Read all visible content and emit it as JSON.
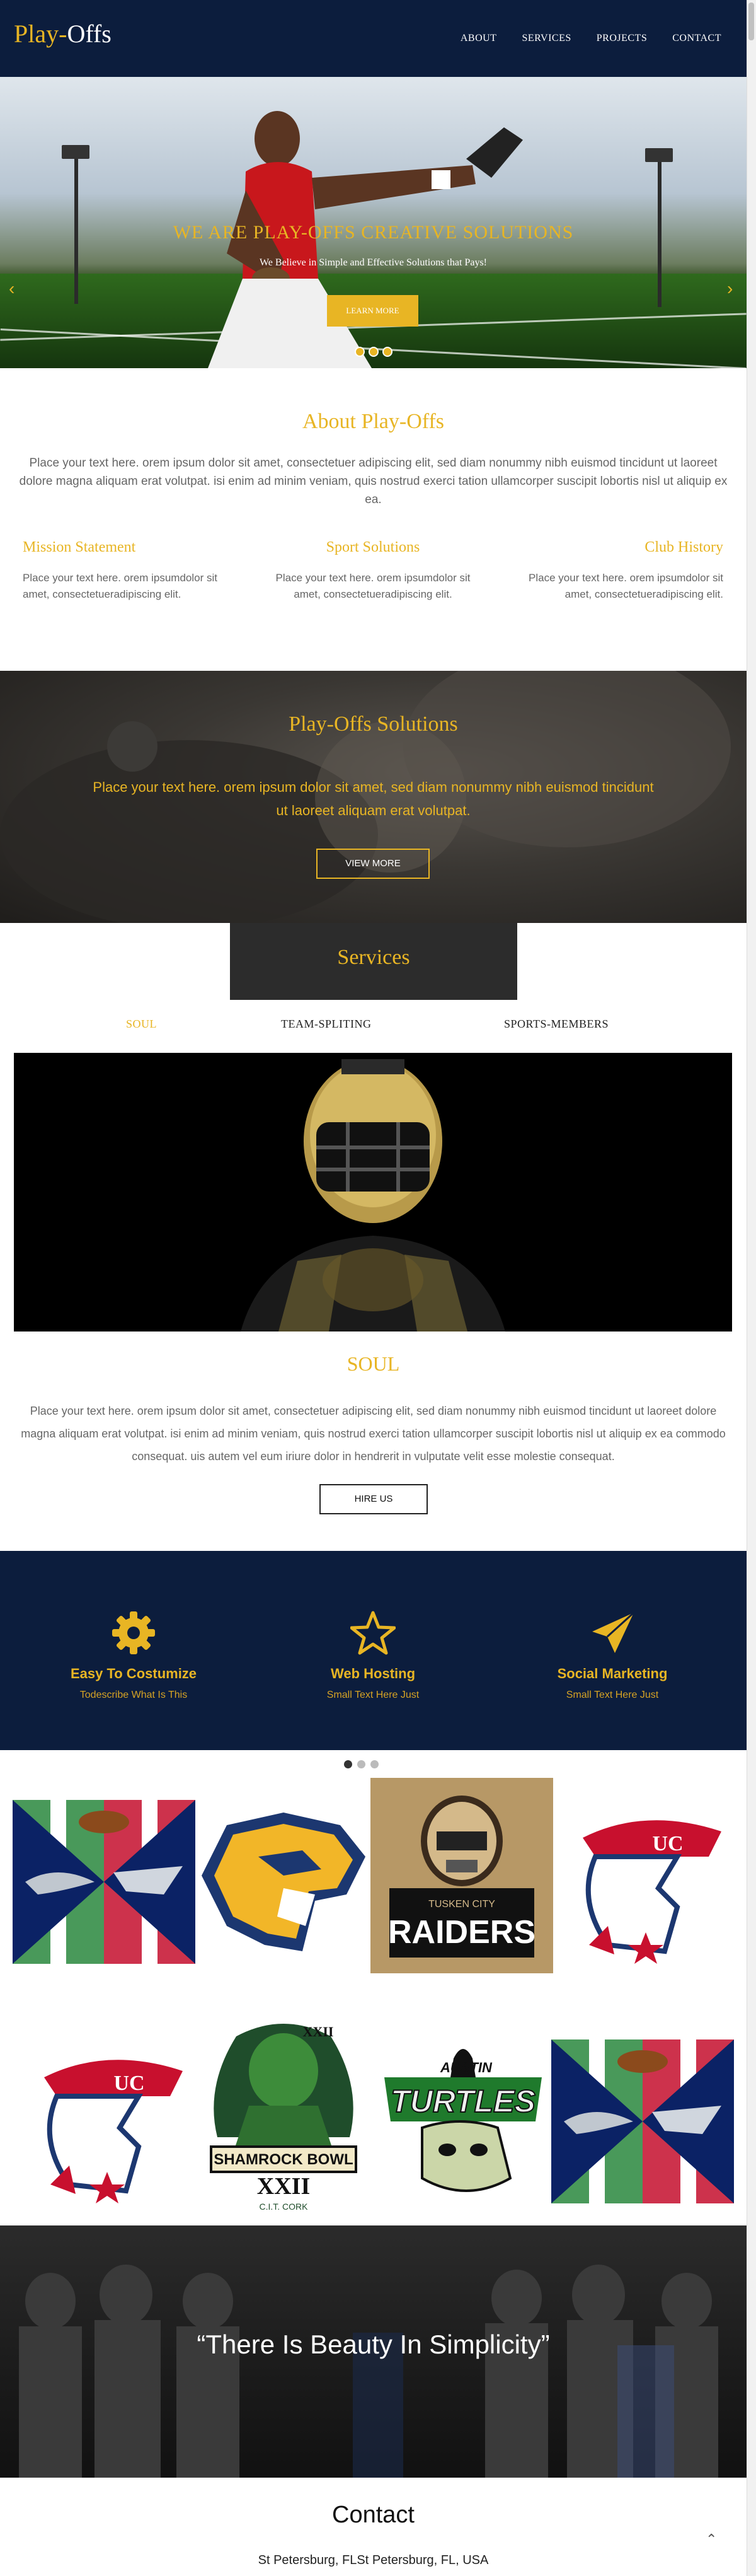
{
  "brand": {
    "part1": "Play-",
    "part2": "Offs"
  },
  "nav": [
    "ABOUT",
    "SERVICES",
    "PROJECTS",
    "CONTACT"
  ],
  "hero": {
    "title": "WE ARE PLAY-OFFS CREATIVE SOLUTIONS",
    "subtitle": "We Believe in Simple and Effective Solutions that Pays!",
    "button": "LEARN MORE",
    "prev_icon": "chevron-left-icon",
    "next_icon": "chevron-right-icon"
  },
  "about": {
    "title": "About Play-Offs",
    "text": "Place your text here. orem ipsum dolor sit amet, consectetuer adipiscing elit, sed diam nonummy nibh euismod tincidunt ut laoreet dolore magna aliquam erat volutpat. isi enim ad minim veniam, quis nostrud exerci tation ullamcorper suscipit lobortis nisl ut aliquip ex ea.",
    "columns": [
      {
        "title": "Mission Statement",
        "text": "Place your text here. orem ipsumdolor sit amet, consectetueradipiscing elit."
      },
      {
        "title": "Sport Solutions",
        "text": "Place your text here. orem ipsumdolor sit amet, consectetueradipiscing elit."
      },
      {
        "title": "Club History",
        "text": "Place your text here. orem ipsumdolor sit amet, consectetueradipiscing elit."
      }
    ]
  },
  "solutions": {
    "title": "Play-Offs Solutions",
    "text": "Place your text here. orem ipsum dolor sit amet, sed diam nonummy nibh euismod tincidunt ut laoreet aliquam erat volutpat.",
    "button": "VIEW MORE"
  },
  "services": {
    "title": "Services",
    "tabs": [
      "SOUL",
      "TEAM-SPLITING",
      "SPORTS-MEMBERS"
    ],
    "active_tab": "SOUL",
    "panel_title": "SOUL",
    "panel_text": "Place your text here. orem ipsum dolor sit amet, consectetuer adipiscing elit, sed diam nonummy nibh euismod tincidunt ut laoreet dolore magna aliquam erat volutpat. isi enim ad minim veniam, quis nostrud exerci tation ullamcorper suscipit lobortis nisl ut aliquip ex ea commodo consequat. uis autem vel eum iriure dolor in hendrerit in vulputate velit esse molestie consequat.",
    "button": "HIRE US"
  },
  "features": [
    {
      "icon": "gear-icon",
      "title": "Easy To Costumize",
      "text": "Todescribe What Is This"
    },
    {
      "icon": "star-icon",
      "title": "Web Hosting",
      "text": "Small Text Here Just"
    },
    {
      "icon": "paper-plane-icon",
      "title": "Social Marketing",
      "text": "Small Text Here Just"
    }
  ],
  "logos": {
    "shamrock": {
      "line1": "XXII",
      "line2": "SHAMROCK BOWL",
      "line3": "XXII",
      "line4": "C.I.T. CORK"
    },
    "raiders": {
      "line1": "TUSKEN CITY",
      "line2": "RAIDERS"
    },
    "austin": {
      "line1": "AUSTIN",
      "line2": "TURTLES"
    },
    "uc": "UC"
  },
  "quote": "“There Is Beauty In Simplicity”",
  "contact": {
    "title": "Contact",
    "address": "St Petersburg, FLSt Petersburg, FL, USA",
    "totop_icon": "chevron-up-icon"
  },
  "colors": {
    "accent": "#e8b524",
    "navy": "#0c1d3d",
    "dark": "#2c2c2c"
  }
}
